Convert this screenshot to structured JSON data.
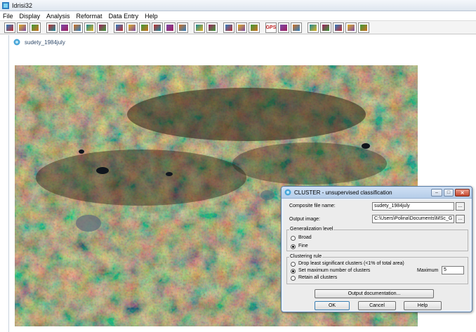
{
  "app": {
    "title": "Idrisi32"
  },
  "menu": [
    "File",
    "Display",
    "Analysis",
    "Reformat",
    "Data Entry",
    "Help"
  ],
  "toolbar_groups": [
    [
      "display-icon",
      "open-folder-icon",
      "palette-icon"
    ],
    [
      "composite-icon",
      "query-icon",
      "pan-icon",
      "swap-icon",
      "layers-icon"
    ],
    [
      "measure-icon",
      "histogram-icon",
      "slice-icon",
      "window-icon",
      "overlay-icon",
      "report-icon"
    ],
    [
      "help-cursor-icon",
      "brush-icon"
    ],
    [
      "target-icon",
      "tools-icon",
      "digitize-icon"
    ],
    [
      "gps-icon",
      "profile-icon",
      "wave-icon"
    ],
    [
      "map-icon",
      "grid-icon",
      "table-icon",
      "legend-icon",
      "eraser-icon"
    ]
  ],
  "toolbar_texts": {
    "gps-icon": "GPS"
  },
  "document": {
    "title": "sudety_1984july"
  },
  "dialog": {
    "title": "CLUSTER - unsupervised classification",
    "composite_label": "Composite file name:",
    "composite_value": "sudety_1984july",
    "output_label": "Output image:",
    "output_value": "C:\\Users\\Polina\\Documents\\MSc_G",
    "browse_label": "...",
    "generalization": {
      "title": "Generalization level",
      "options": [
        "Broad",
        "Fine"
      ],
      "selected": "Fine"
    },
    "clustering": {
      "title": "Clustering rule",
      "options": [
        "Drop least significant clusters (<1% of total area)",
        "Set maximum number of clusters",
        "Retain all clusters"
      ],
      "selected": "Set maximum number of clusters",
      "maximum_label": "Maximum",
      "maximum_value": "5"
    },
    "output_doc_label": "Output documentation...",
    "ok_label": "OK",
    "cancel_label": "Cancel",
    "help_label": "Help"
  }
}
